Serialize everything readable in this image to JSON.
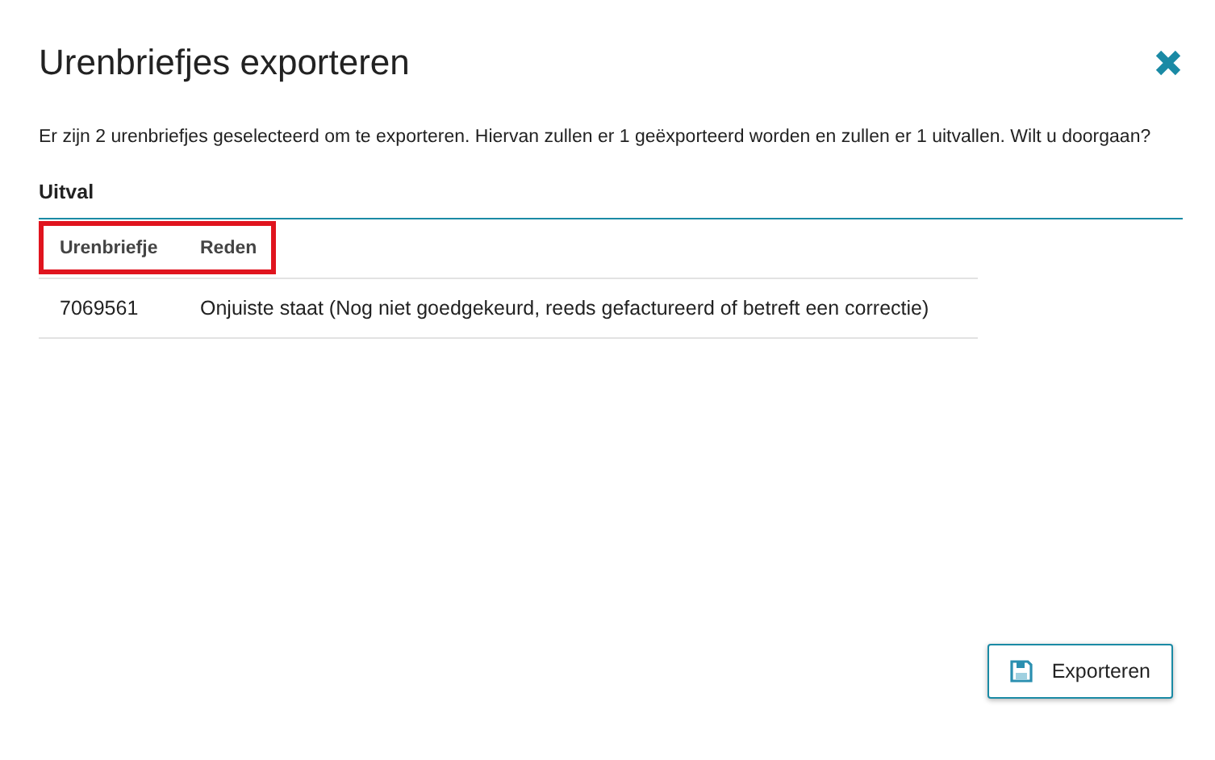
{
  "dialog": {
    "title": "Urenbriefjes exporteren",
    "message": "Er zijn 2 urenbriefjes geselecteerd om te exporteren. Hiervan zullen er 1 geëxporteerd worden en zullen er 1 uitvallen. Wilt u doorgaan?"
  },
  "section": {
    "title": "Uitval"
  },
  "table": {
    "header_highlighted": true,
    "columns": [
      "Urenbriefje",
      "Reden"
    ],
    "rows": [
      [
        "7069561",
        "Onjuiste staat (Nog niet goedgekeurd, reeds gefactureerd of betreft een correctie)"
      ]
    ]
  },
  "buttons": [
    {
      "label": "Exporteren",
      "kind": "save"
    }
  ]
}
